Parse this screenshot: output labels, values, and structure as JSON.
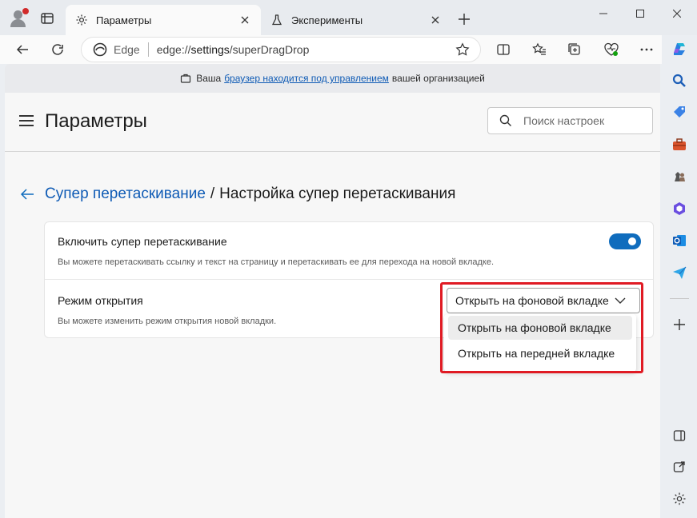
{
  "tabs": [
    {
      "title": "Параметры",
      "active": true
    },
    {
      "title": "Эксперименты",
      "active": false
    }
  ],
  "address": {
    "site_label": "Edge",
    "url_prefix": "edge://",
    "url_host": "settings",
    "url_path": "/superDragDrop"
  },
  "banner": {
    "before": "Ваша",
    "link": "браузер находится под управлением",
    "after": "вашей организацией"
  },
  "header": {
    "title": "Параметры",
    "search_placeholder": "Поиск настроек"
  },
  "breadcrumb": {
    "parent": "Супер перетаскивание",
    "separator": "/",
    "current": "Настройка супер перетаскивания"
  },
  "settings": {
    "enable": {
      "label": "Включить супер перетаскивание",
      "description": "Вы можете перетаскивать ссылку и текст на страницу и перетаскивать ее для перехода на новой вкладке.",
      "enabled": true
    },
    "mode": {
      "label": "Режим открытия",
      "description": "Вы можете изменить режим открытия новой вкладки.",
      "selected": "Открыть на фоновой вкладке",
      "options": [
        "Открыть на фоновой вкладке",
        "Открыть на передней вкладке"
      ]
    }
  },
  "colors": {
    "accent": "#0f6cbd",
    "link": "#0f5bb5",
    "highlight": "#e01b24"
  }
}
